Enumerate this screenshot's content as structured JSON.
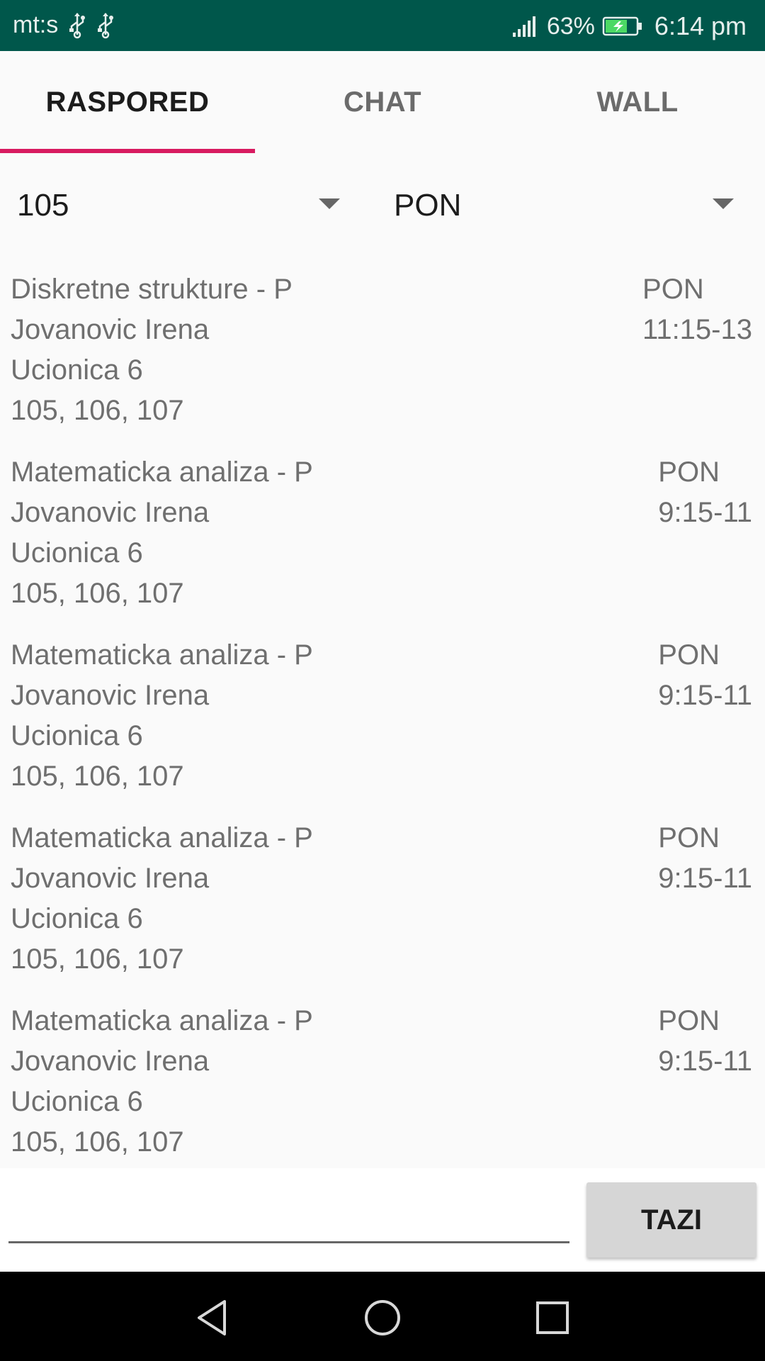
{
  "status_bar": {
    "carrier": "mt:s",
    "battery_percent": "63%",
    "time": "6:14 pm",
    "icons": [
      "usb-icon",
      "usb-icon",
      "signal-icon",
      "battery-charging-icon"
    ]
  },
  "tabs": [
    {
      "label": "RASPORED",
      "active": true
    },
    {
      "label": "CHAT",
      "active": false
    },
    {
      "label": "WALL",
      "active": false
    }
  ],
  "filters": {
    "group_value": "105",
    "day_value": "PON"
  },
  "schedule": [
    {
      "subject": "Diskretne strukture - P",
      "teacher": "Jovanovic Irena",
      "room": "Ucionica 6",
      "groups": "105, 106, 107",
      "day": "PON",
      "time": "11:15-13"
    },
    {
      "subject": "Matematicka analiza - P",
      "teacher": "Jovanovic Irena",
      "room": "Ucionica 6",
      "groups": "105, 106, 107",
      "day": "PON",
      "time": "9:15-11"
    },
    {
      "subject": "Matematicka analiza - P",
      "teacher": "Jovanovic Irena",
      "room": "Ucionica 6",
      "groups": "105, 106, 107",
      "day": "PON",
      "time": "9:15-11"
    },
    {
      "subject": "Matematicka analiza - P",
      "teacher": "Jovanovic Irena",
      "room": "Ucionica 6",
      "groups": "105, 106, 107",
      "day": "PON",
      "time": "9:15-11"
    },
    {
      "subject": "Matematicka analiza - P",
      "teacher": "Jovanovic Irena",
      "room": "Ucionica 6",
      "groups": "105, 106, 107",
      "day": "PON",
      "time": "9:15-11"
    }
  ],
  "search": {
    "input_value": "",
    "button_label": "TAZI"
  },
  "colors": {
    "status_bar": "#00574b",
    "tab_indicator": "#d81b60",
    "background": "#fafafa"
  }
}
